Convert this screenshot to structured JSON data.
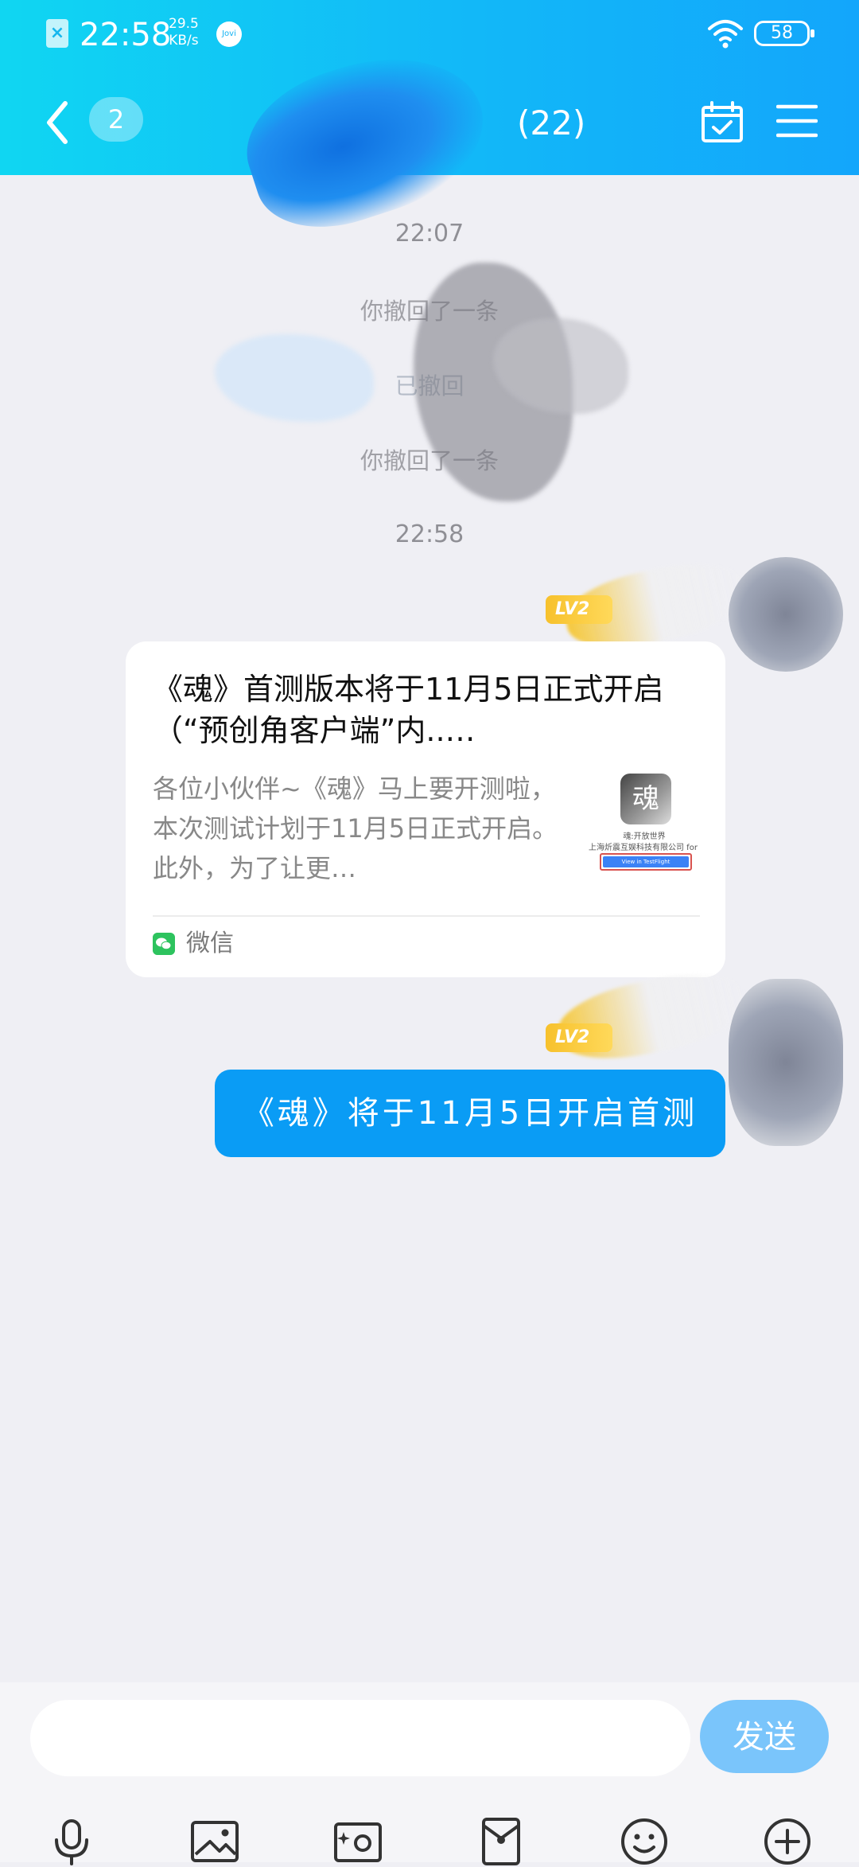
{
  "status_bar": {
    "time": "22:58",
    "speed_value": "29.5",
    "speed_unit": "KB/s",
    "assistant_badge": "Jovi",
    "battery": "58"
  },
  "header": {
    "unread_count": "2",
    "title_suffix": "(22)"
  },
  "chat": {
    "timestamp_1": "22:07",
    "recall_1": "你撤回了一条",
    "recall_2": "已撤回",
    "recall_3": "你撤回了一条",
    "timestamp_2": "22:58",
    "level_badge": "LV2",
    "share_card": {
      "title": "《魂》首测版本将于11月5日正式开启（“预创角客户端”内..…",
      "description": "各位小伙伴~《魂》马上要开测啦，本次测试计划于11月5日正式开启。此外，为了让更…",
      "thumb_logo_char": "魂",
      "thumb_caption_1": "魂:开放世界",
      "thumb_caption_2": "上海炘震互娱科技有限公司 for iPhone",
      "thumb_button": "View in TestFlight",
      "source": "微信"
    },
    "text_message": "《魂》将于11月5日开启首测"
  },
  "input": {
    "placeholder": "",
    "send_label": "发送"
  },
  "colors": {
    "header_start": "#10d6f2",
    "header_end": "#13a6fb",
    "bubble": "#0a9cf5",
    "send_button": "#7ac5fb",
    "level_badge": "#f7c12c",
    "wechat_green": "#2dc35e"
  },
  "icons": {
    "header": [
      "back-icon",
      "calendar-check-icon",
      "menu-icon"
    ],
    "toolbar": [
      "microphone-icon",
      "image-icon",
      "camera-icon",
      "red-packet-icon",
      "emoji-icon",
      "plus-icon"
    ]
  }
}
